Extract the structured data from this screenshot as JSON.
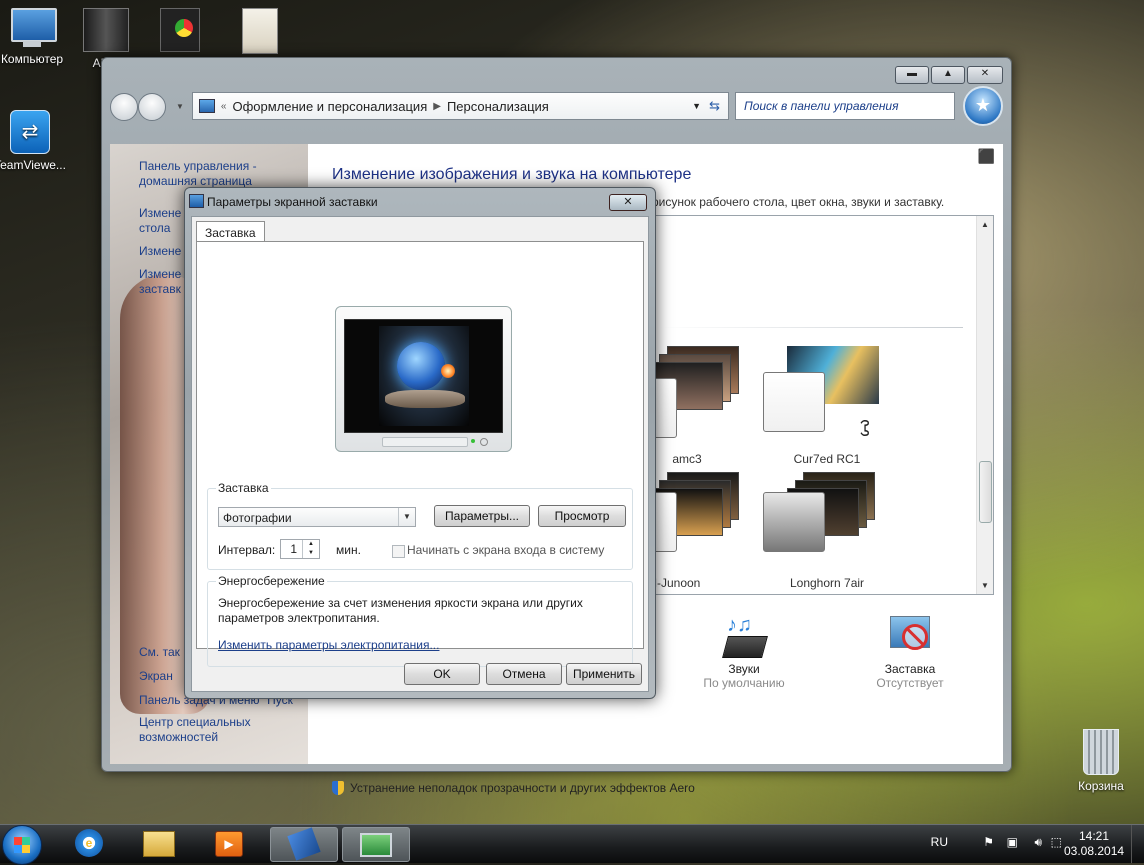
{
  "desktop": {
    "icons": [
      {
        "label": "Компьютер"
      },
      {
        "label": "AKTI"
      },
      {
        "label": ""
      },
      {
        "label": ""
      },
      {
        "label": "TeamViewe..."
      }
    ],
    "recycle_bin": "Корзина"
  },
  "control_panel": {
    "address": {
      "crumb1": "Оформление и персонализация",
      "crumb2": "Персонализация"
    },
    "search_placeholder": "Поиск в панели управления",
    "left_links": {
      "home1": "Панель управления -",
      "home2": "домашняя страница",
      "link2a": "Измене",
      "link2b": "стола",
      "link3": "Измене",
      "link4a": "Измене",
      "link4b": "заставк",
      "see_also": "См. так",
      "screen": "Экран",
      "taskbar": "Панель задач и меню \"Пуск\"",
      "center1": "Центр специальных",
      "center2": "возможностей"
    },
    "heading": "Изменение изображения и звука на компьютере",
    "subtitle": "рисунок рабочего стола, цвет окна, звуки и заставку.",
    "themes": [
      {
        "name": "amc3"
      },
      {
        "name": "Cur7ed RC1"
      },
      {
        "name": "LH-Junoon"
      },
      {
        "name": "Longhorn 7air"
      }
    ],
    "bottom": {
      "sounds_title": "Звуки",
      "sounds_sub": "По умолчанию",
      "saver_title": "Заставка",
      "saver_sub": "Отсутствует"
    },
    "aero_link": "Устранение неполадок прозрачности и других эффектов Aero"
  },
  "dialog": {
    "title": "Параметры экранной заставки",
    "tab": "Заставка",
    "saver_group": "Заставка",
    "saver_selected": "Фотографии",
    "params_btn": "Параметры...",
    "preview_btn": "Просмотр",
    "interval_label": "Интервал:",
    "interval_value": "1",
    "minutes": "мин.",
    "login_checkbox": "Начинать с экрана входа в систему",
    "login_checked": false,
    "power_group": "Энергосбережение",
    "power_text1": "Энергосбережение за счет изменения яркости экрана или других",
    "power_text2": "параметров электропитания.",
    "power_link": "Изменить параметры электропитания...",
    "ok": "OK",
    "cancel": "Отмена",
    "apply": "Применить"
  },
  "taskbar": {
    "lang": "RU",
    "time": "14:21",
    "date": "03.08.2014"
  }
}
